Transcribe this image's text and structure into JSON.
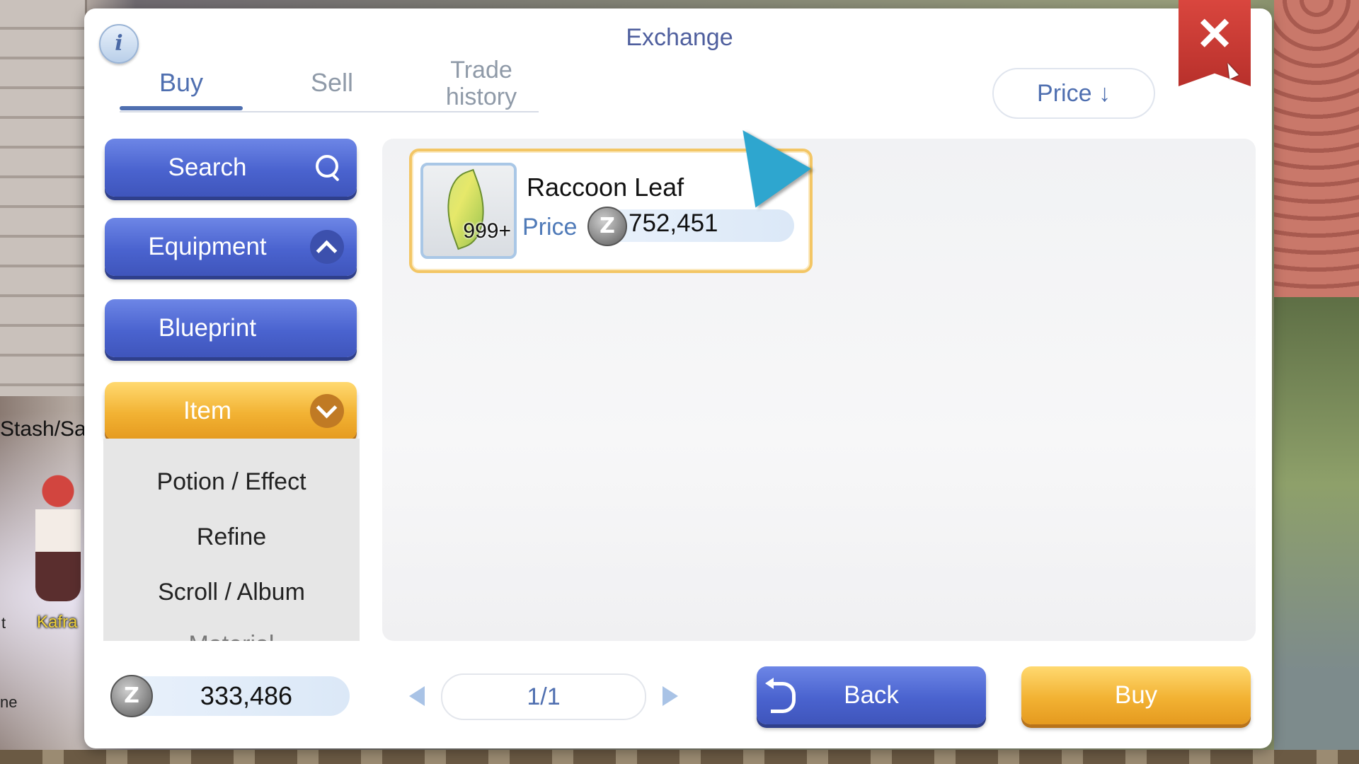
{
  "dialog": {
    "title": "Exchange",
    "info_icon": "i",
    "close_icon": "✕"
  },
  "tabs": [
    {
      "label": "Buy",
      "active": true
    },
    {
      "label": "Sell",
      "active": false
    },
    {
      "label": "Trade history",
      "active": false
    }
  ],
  "sort": {
    "label": "Price ↓"
  },
  "menu": {
    "search": "Search",
    "equipment": "Equipment",
    "blueprint": "Blueprint",
    "item": "Item",
    "sub_items": [
      "Potion / Effect",
      "Refine",
      "Scroll / Album",
      "Material"
    ]
  },
  "listing": [
    {
      "name": "Raccoon Leaf",
      "quantity": "999+",
      "price_label": "Price",
      "price": "752,451",
      "icon": "leaf-icon"
    }
  ],
  "footer": {
    "zeny_symbol": "Z",
    "zeny": "333,486",
    "page": "1/1",
    "back_label": "Back",
    "buy_label": "Buy"
  },
  "background": {
    "stash_label": "Stash/Sa",
    "npc_name": "Kafra",
    "edge_left_1": "t",
    "edge_left_2": "ne"
  },
  "colors": {
    "accent_blue": "#4a63cf",
    "accent_orange": "#f2b233",
    "close_red": "#d9463e",
    "title_text": "#4f5f9e"
  }
}
